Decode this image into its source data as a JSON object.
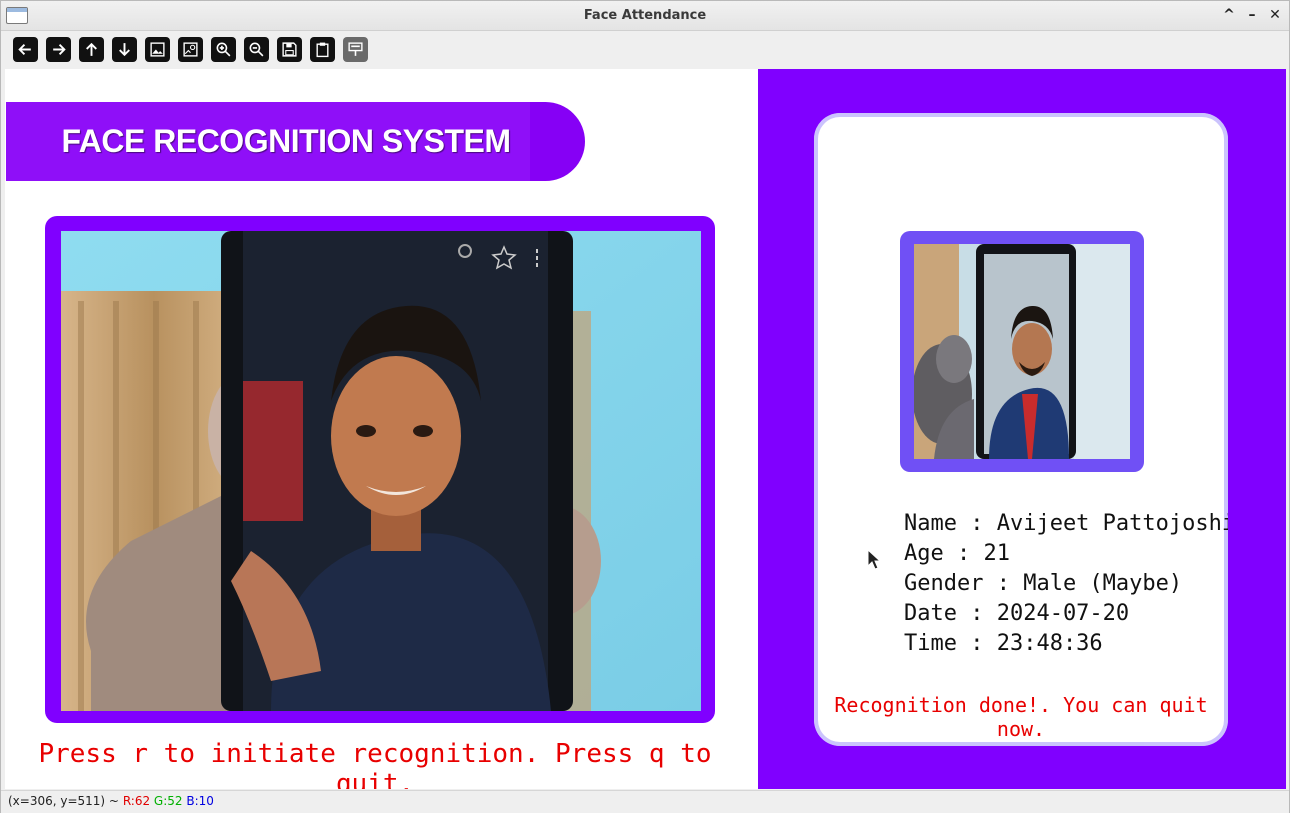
{
  "window": {
    "title": "Face Attendance"
  },
  "window_controls": {
    "maximize": "^",
    "minimize": "–",
    "close": "✕"
  },
  "toolbar": {
    "buttons": [
      {
        "name": "arrow-left-icon"
      },
      {
        "name": "arrow-right-icon"
      },
      {
        "name": "arrow-up-icon"
      },
      {
        "name": "arrow-down-icon"
      },
      {
        "name": "image-icon"
      },
      {
        "name": "image-properties-icon"
      },
      {
        "name": "zoom-in-icon"
      },
      {
        "name": "zoom-out-icon"
      },
      {
        "name": "save-icon"
      },
      {
        "name": "clipboard-icon"
      },
      {
        "name": "properties-icon"
      }
    ]
  },
  "banner": {
    "title": "FACE RECOGNITION SYSTEM"
  },
  "camera": {
    "hint": "Press r to initiate recognition. Press q to quit."
  },
  "result": {
    "name": "Name : Avijeet Pattojoshi",
    "age": "Age : 21",
    "gender": "Gender : Male (Maybe)",
    "date": "Date : 2024-07-20",
    "time": "Time : 23:48:36",
    "status": "Recognition done!. You can quit now."
  },
  "statusbar": {
    "coords": "(x=306, y=511) ~",
    "r": "R:62",
    "g": "G:52",
    "b": "B:10"
  },
  "colors": {
    "accent": "#8000ff",
    "banner": "#8600f5",
    "thumb_frame": "#7050f5",
    "message_red": "#e80000"
  }
}
